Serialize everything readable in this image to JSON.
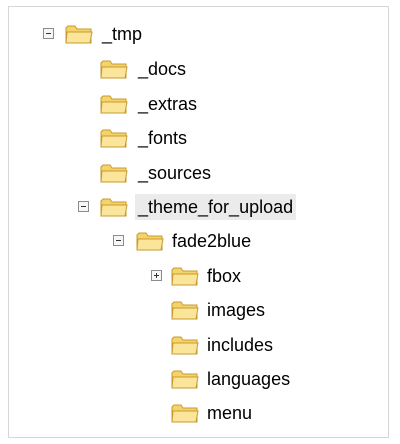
{
  "tree": [
    {
      "label": "_tmp",
      "expanded": true,
      "has_toggle": true
    },
    {
      "label": "_docs"
    },
    {
      "label": "_extras"
    },
    {
      "label": "_fonts"
    },
    {
      "label": "_sources"
    },
    {
      "label": "_theme_for_upload",
      "expanded": true,
      "has_toggle": true,
      "selected": true
    },
    {
      "label": "fade2blue",
      "expanded": true,
      "has_toggle": true
    },
    {
      "label": "fbox",
      "expanded": false,
      "has_toggle": true
    },
    {
      "label": "images"
    },
    {
      "label": "includes"
    },
    {
      "label": "languages"
    },
    {
      "label": "menu"
    }
  ],
  "colors": {
    "folder_fill": "#f3d36a",
    "folder_edge": "#c89a2d",
    "folder_front": "#fbe59a",
    "selection_bg": "#ebebeb"
  },
  "icons": {
    "folder": "folder-icon",
    "expanded": "minus-box-icon",
    "collapsed": "plus-box-icon"
  }
}
